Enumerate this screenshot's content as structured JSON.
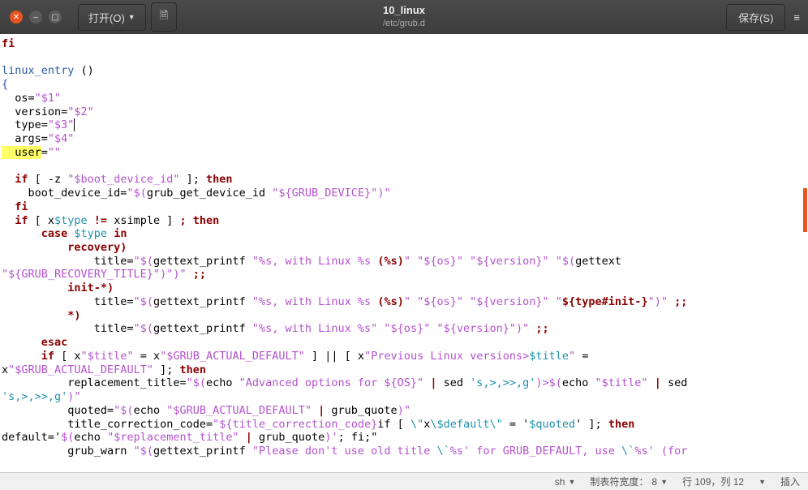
{
  "titlebar": {
    "open_label": "打开(O)",
    "title": "10_linux",
    "subtitle": "/etc/grub.d",
    "save_label": "保存(S)"
  },
  "code": {
    "l1": "fi",
    "l2_fn": "linux_entry",
    "l2_rest": " ()",
    "l3": "{",
    "l4a": "  os=",
    "l4b": "\"$1\"",
    "l5a": "  version=",
    "l5b": "\"$2\"",
    "l6a": "  type=",
    "l6b": "\"$3\"",
    "l7a": "  args=",
    "l7b": "\"$4\"",
    "l8a_hl": "  user",
    "l8a2": "=",
    "l8b": "\"\"",
    "l9": "",
    "l10a": "  if",
    "l10b": " [ -z ",
    "l10c": "\"$boot_device_id\"",
    "l10d": " ]; ",
    "l10e": "then",
    "l11a": "    boot_device_id=",
    "l11b": "\"$(",
    "l11c": "grub_get_device_id ",
    "l11d": "\"${GRUB_DEVICE}\"",
    "l11e": ")\"",
    "l12": "  fi",
    "l13a": "  if",
    "l13b": " [ x",
    "l13c": "$type",
    "l13d": " != ",
    "l13e": "xsimple ] ",
    "l13f": ";",
    "l13g": " then",
    "l14a": "      case",
    "l14b": " $type",
    "l14c": " in",
    "l15": "          recovery)",
    "l16a": "              title=",
    "l16b": "\"$(",
    "l16c": "gettext_printf ",
    "l16d": "\"%s, with Linux %s ",
    "l16d2": "(%s)",
    "l16d3": "\" \"${os}\" \"${version}\" ",
    "l16e": "\"$(",
    "l16f": "gettext ",
    "l17a": "\"${GRUB_RECOVERY_TITLE}\"",
    "l17b": ")\"",
    "l17c": ")\"",
    "l17d": " ;;",
    "l18a": "          init-*)",
    "l19a": "              title=",
    "l19b": "\"$(",
    "l19c": "gettext_printf ",
    "l19d": "\"%s, with Linux %s ",
    "l19d2": "(%s)",
    "l19d3": "\" \"${os}\" \"${version}\" \"",
    "l19e": "${type#init-}",
    "l19f": "\"",
    "l19g": ")\"",
    "l19h": " ;;",
    "l20": "          *)",
    "l21a": "              title=",
    "l21b": "\"$(",
    "l21c": "gettext_printf ",
    "l21d": "\"%s, with Linux %s\" \"${os}\" \"${version}\"",
    "l21e": ")\"",
    "l21f": " ;;",
    "l22a": "      esac",
    "l23a": "      if",
    "l23b": " [ x",
    "l23c": "\"$title\"",
    "l23d": " = x",
    "l23e": "\"$GRUB_ACTUAL_DEFAULT\"",
    "l23f": " ] || [ x",
    "l23g": "\"Previous Linux versions>",
    "l23h": "$title",
    "l23i": "\"",
    "l23j": " = ",
    "l24a": "x",
    "l24b": "\"$GRUB_ACTUAL_DEFAULT\"",
    "l24c": " ]; ",
    "l24d": "then",
    "l25a": "          replacement_title=",
    "l25b": "\"$(",
    "l25c": "echo ",
    "l25d": "\"Advanced options for ${OS}\"",
    "l25e": " | ",
    "l25f": "sed ",
    "l25g": "'s,>,>>,g'",
    "l25h": ")>$(",
    "l25i": "echo ",
    "l25j": "\"$title\"",
    "l25k": " | ",
    "l25l": "sed ",
    "l26a": "'s,>,>>,g'",
    "l26b": ")\"",
    "l27a": "          quoted=",
    "l27b": "\"$(",
    "l27c": "echo ",
    "l27d": "\"$GRUB_ACTUAL_DEFAULT\"",
    "l27e": " | ",
    "l27f": "grub_quote",
    "l27g": ")\"",
    "l28a": "          title_correction_code=",
    "l28b": "\"${title_correction_code}",
    "l28c": "if [ ",
    "l28d": "\\\"",
    "l28e": "x",
    "l28f": "\\$default\\\"",
    "l28g": " = '",
    "l28h": "$quoted",
    "l28i": "' ]; ",
    "l28j": "then ",
    "l29a": "default='",
    "l29b": "$(",
    "l29c": "echo ",
    "l29d": "\"$replacement_title\"",
    "l29e": " | ",
    "l29f": "grub_quote",
    "l29g": ")'",
    "l29h": "; fi;\"",
    "l30a": "          grub_warn ",
    "l30b": "\"$(",
    "l30c": "gettext_printf ",
    "l30d": "\"Please don't use old title ",
    "l30e": "\\`",
    "l30f": "%s' for GRUB_DEFAULT, use ",
    "l30g": "\\`",
    "l30h": "%s' (for "
  },
  "statusbar": {
    "lang": "sh",
    "tab_label": "制表符宽度：",
    "tab_val": "8",
    "pos_label": "行 109，列 12",
    "mode": "插入"
  }
}
